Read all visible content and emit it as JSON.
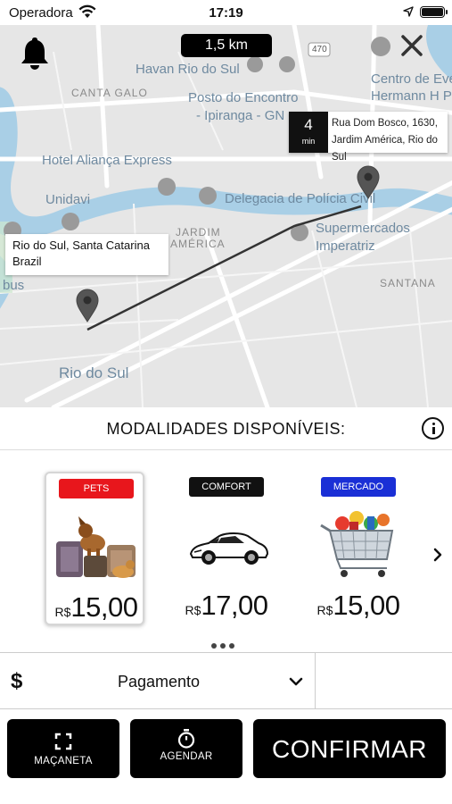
{
  "status_bar": {
    "carrier": "Operadora",
    "time": "17:19"
  },
  "map": {
    "distance": "1,5 km",
    "labels": {
      "havan": "Havan Rio do Sul",
      "canta_galo": "CANTA GALO",
      "posto": "Posto do Encontro",
      "ipiranga": "- Ipiranga - GN",
      "hotel": "Hotel Aliança Express",
      "unidavi": "Unidavi",
      "delegacia": "Delegacia de Polícia Civil",
      "jardim": "JARDIM",
      "america": "AMÉRICA",
      "supermercados": "Supermercados",
      "imperatriz": "Imperatriz",
      "santana": "SANTANA",
      "centro_1": "Centro de Eve",
      "centro_2": "Hermann H Pe",
      "bus": "bus",
      "rio_do_sul": "Rio do Sul",
      "route_470": "470"
    },
    "destination": {
      "minutes": "4",
      "unit": "min",
      "line1": "Rua Dom Bosco, 1630,",
      "line2": "Jardim América, Rio do Sul"
    },
    "origin": {
      "line1": "Rio do Sul, Santa Catarina",
      "line2": "Brazil"
    }
  },
  "modalities": {
    "title": "MODALIDADES DISPONÍVEIS:",
    "options": [
      {
        "badge": "PETS",
        "badge_color": "#e8161c",
        "currency": "R$",
        "price": "15,00",
        "selected": true,
        "icon": "pets-image"
      },
      {
        "badge": "COMFORT",
        "badge_color": "#111111",
        "currency": "R$",
        "price": "17,00",
        "selected": false,
        "icon": "car-image"
      },
      {
        "badge": "MERCADO",
        "badge_color": "#1a2fd6",
        "currency": "R$",
        "price": "15,00",
        "selected": false,
        "icon": "grocery-cart-image"
      }
    ]
  },
  "payment": {
    "symbol": "$",
    "label": "Pagamento"
  },
  "actions": {
    "macaneta": "MAÇANETA",
    "agendar": "AGENDAR",
    "confirmar": "CONFIRMAR"
  }
}
